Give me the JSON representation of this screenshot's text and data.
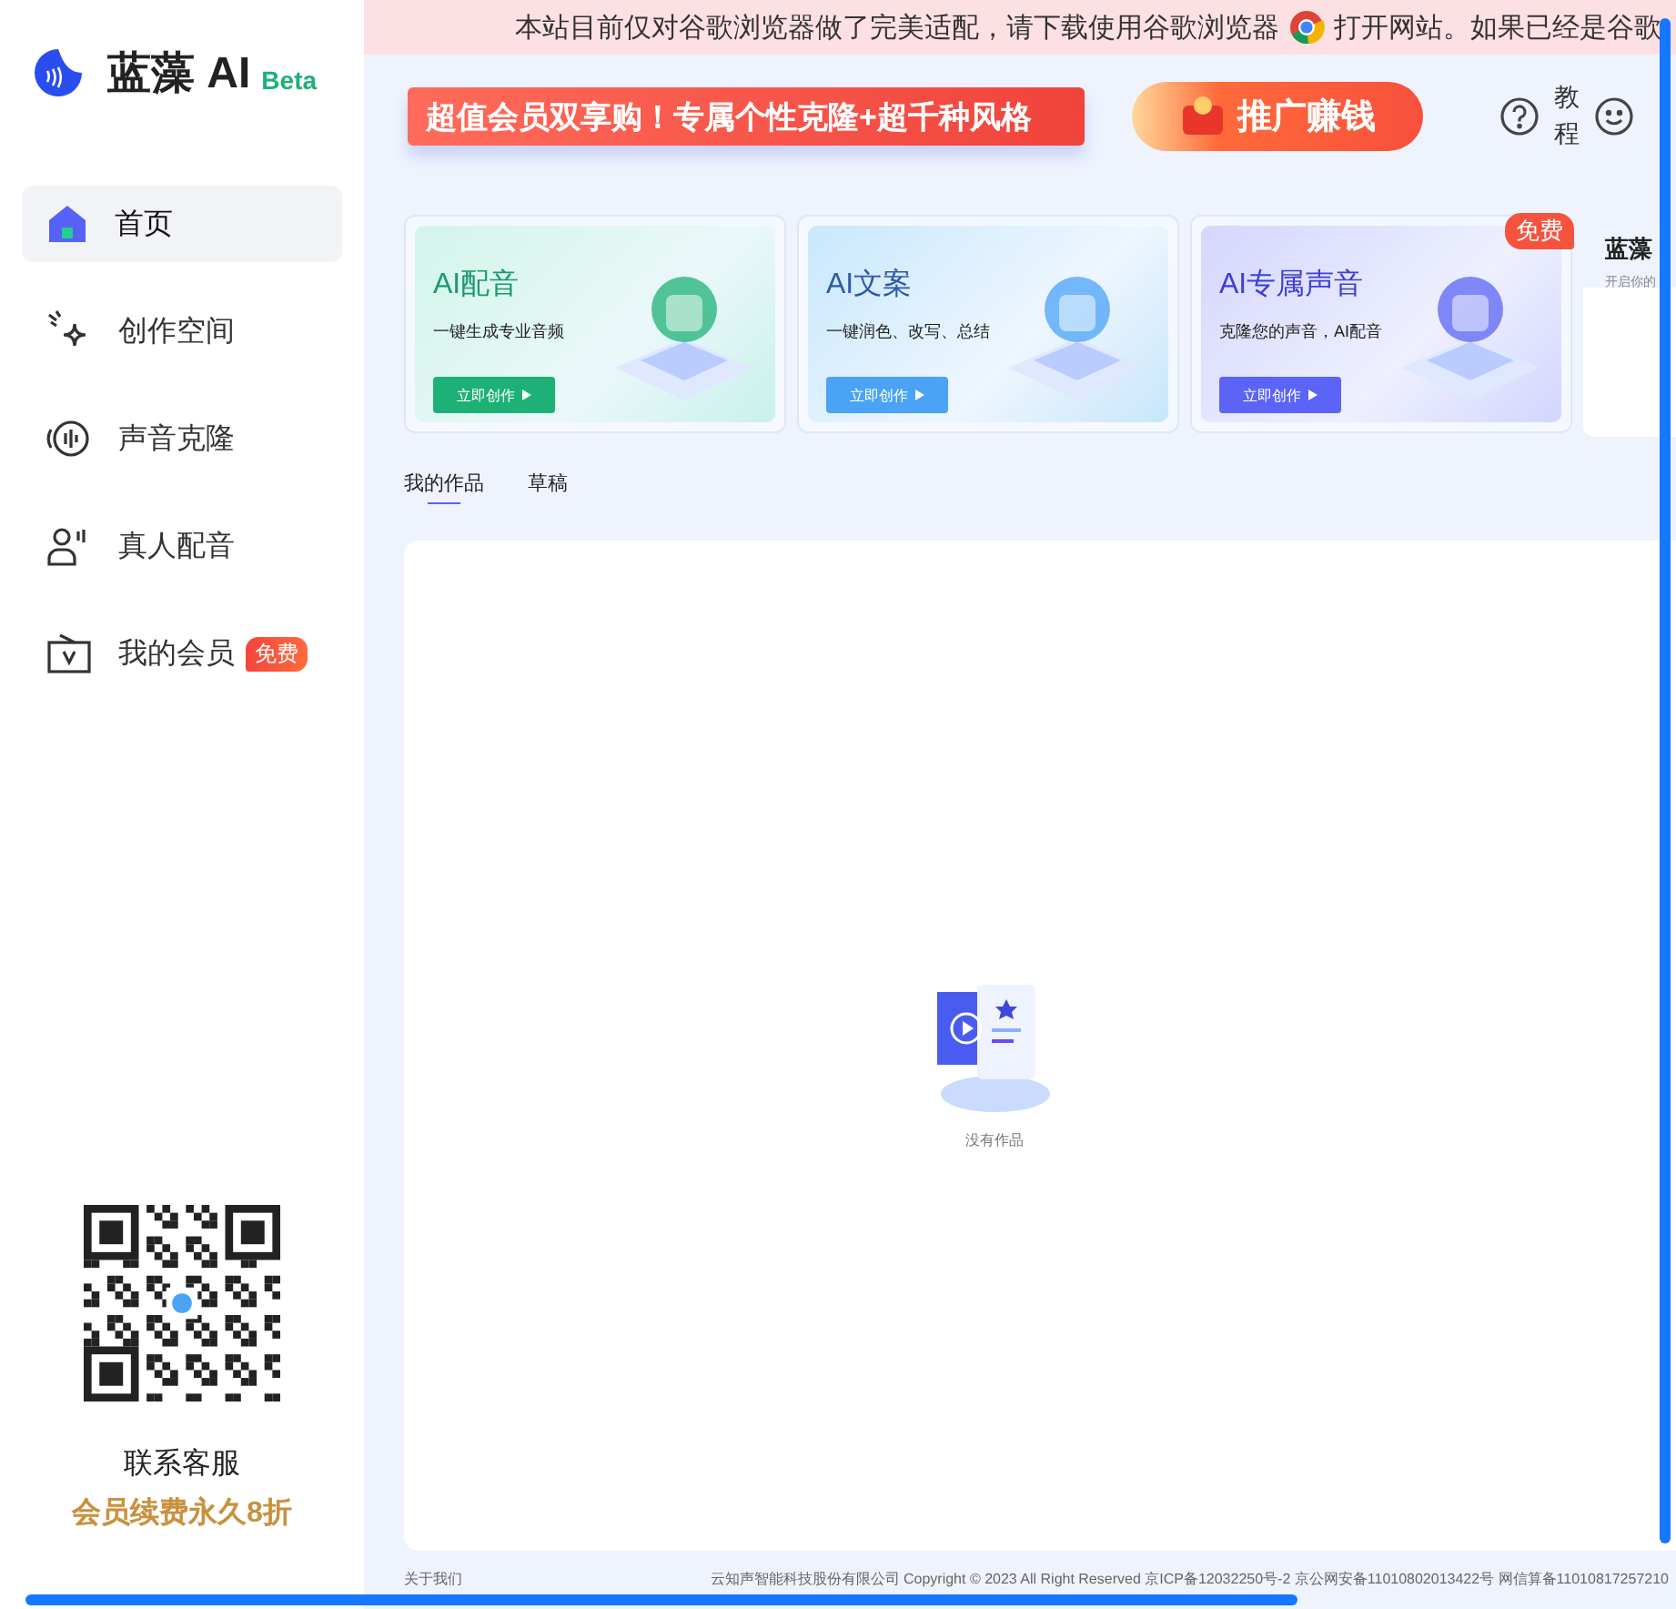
{
  "notice": {
    "text_before": "本站目前仅对谷歌浏览器做了完美适配，请下载使用谷歌浏览器",
    "text_after": "打开网站。如果已经是谷歌"
  },
  "brand": {
    "name": "蓝藻 AI",
    "badge": "Beta"
  },
  "nav": [
    {
      "label": "首页",
      "selected": true
    },
    {
      "label": "创作空间",
      "selected": false
    },
    {
      "label": "声音克隆",
      "selected": false
    },
    {
      "label": "真人配音",
      "selected": false
    },
    {
      "label": "我的会员",
      "selected": false,
      "badge": "免费"
    }
  ],
  "contact": {
    "caption": "联系客服",
    "promo": "会员续费永久8折"
  },
  "banners": [
    {
      "kind": "promo",
      "text": "超值会员双享购！专属个性克隆+超千种风格"
    },
    {
      "kind": "earn",
      "text": "推广赚钱"
    }
  ],
  "help": {
    "label": "教程"
  },
  "cards": [
    {
      "title": "AI配音",
      "subtitle": "一键生成专业音频",
      "button": "立即创作",
      "color": "#1db177"
    },
    {
      "title": "AI文案",
      "subtitle": "一键润色、改写、总结",
      "button": "立即创作",
      "color": "#4aa3f5"
    },
    {
      "title": "AI专属声音",
      "subtitle": "克隆您的声音，AI配音",
      "button": "立即创作",
      "color": "#5b64f6",
      "badge": "免费"
    }
  ],
  "partial_card": {
    "title": "蓝藻",
    "subtitle": "开启你的"
  },
  "tabs": [
    {
      "label": "我的作品",
      "selected": true
    },
    {
      "label": "草稿",
      "selected": false
    }
  ],
  "empty": {
    "text": "没有作品"
  },
  "footer": {
    "about": "关于我们",
    "copyright": "云知声智能科技股份有限公司 Copyright © 2023 All Right Reserved 京ICP备12032250号-2 京公网安备11010802013422号 网信算备11010817257210"
  }
}
